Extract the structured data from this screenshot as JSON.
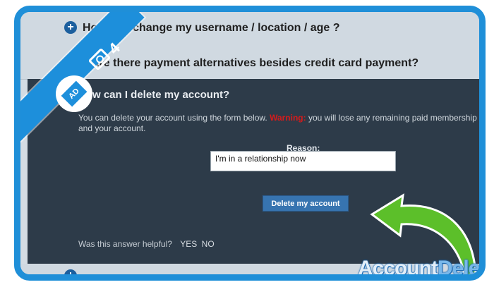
{
  "faq": {
    "item1_question": "How do I change my username / location / age ?",
    "item2_question": "Are there payment alternatives besides credit card payment?",
    "item4_question": ""
  },
  "panel": {
    "title": "How can I delete my account?",
    "text_before": "You can delete your account using the form below. ",
    "warning_label": "Warning:",
    "text_after": " you will lose any remaining paid membership and your account.",
    "reason_label": "Reason:",
    "reason_value": "I'm in a relationship now",
    "delete_button": "Delete my account",
    "helpful_question": "Was this answer helpful?",
    "helpful_yes": "YES",
    "helpful_no": "NO"
  },
  "overlay": {
    "step_number": "4",
    "logo_text": "AD",
    "watermark_part1": "Account",
    "watermark_part2": "Deleters"
  },
  "colors": {
    "frame": "#1f8fd8",
    "panel_bg": "#2d3b49",
    "warning": "#d41b1b",
    "button": "#3774b0",
    "arrow": "#5cbf2a"
  },
  "icons": [
    "plus-icon",
    "camera-icon",
    "account-deleters-logo-icon",
    "arrow-icon"
  ]
}
